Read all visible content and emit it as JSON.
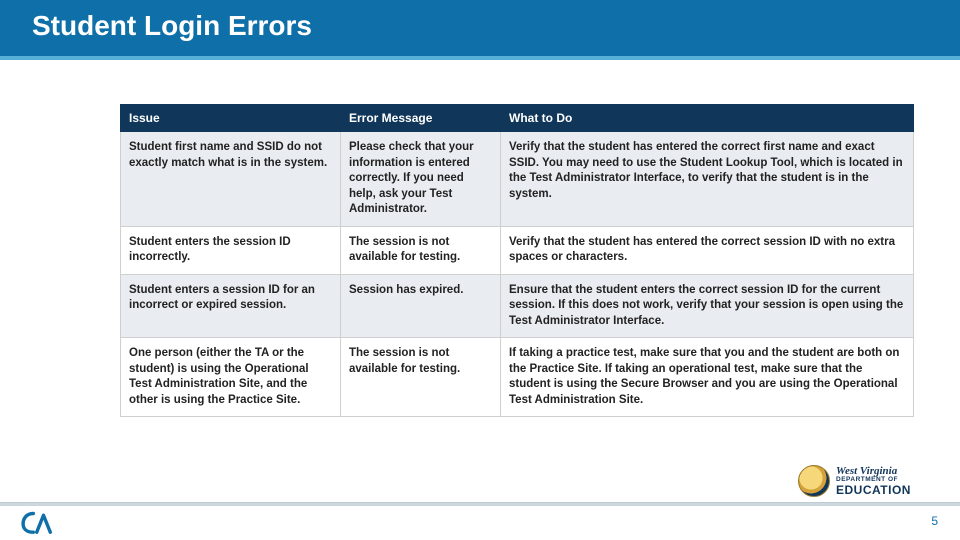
{
  "title": "Student Login Errors",
  "headers": {
    "issue": "Issue",
    "error": "Error Message",
    "todo": "What to Do"
  },
  "rows": [
    {
      "issue": "Student first name and SSID do not exactly match what is in the system.",
      "error": "Please check that your information is entered correctly. If you need help, ask your Test Administrator.",
      "todo": "Verify that the student has entered the correct first name and exact SSID. You may need to use the Student Lookup Tool, which is located in the Test Administrator Interface, to verify that the student is in the system."
    },
    {
      "issue": "Student enters the session ID incorrectly.",
      "error": "The session is not available for testing.",
      "todo": "Verify that the student has entered the correct session ID with no extra spaces or characters."
    },
    {
      "issue": "Student enters a session ID for an incorrect or expired session.",
      "error": "Session has expired.",
      "todo": "Ensure that the student enters the correct session ID for the current session. If this does not work, verify that your session is open using the Test Administrator Interface."
    },
    {
      "issue": "One person (either the TA or the student) is using the Operational Test Administration Site, and the other is using the Practice Site.",
      "error": "The session is not available for testing.",
      "todo": "If taking a practice test, make sure that you and the student are both on the Practice Site. If taking an operational test, make sure that the student is using the Secure Browser and you are using the Operational Test Administration Site."
    }
  ],
  "footer": {
    "page_number": "5",
    "wv_state": "West Virginia",
    "wv_dept": "DEPARTMENT OF",
    "wv_edu": "EDUCATION"
  }
}
